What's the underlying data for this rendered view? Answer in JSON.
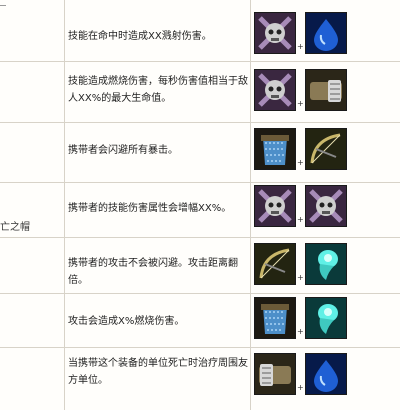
{
  "rows": [
    {
      "desc": "技能在命中时造成XX溅射伤害。",
      "icons": [
        "skull-crossbones-icon",
        "blue-drop-icon"
      ]
    },
    {
      "desc": "技能造成燃烧伤害，每秒伤害值相当于敌人XX%的最大生命值。",
      "icons": [
        "skull-crossbones-icon",
        "gauntlet-icon"
      ]
    },
    {
      "desc": "携带者会闪避所有暴击。",
      "icons": [
        "chainmail-icon",
        "bow-icon"
      ]
    },
    {
      "desc": "携带者的技能伤害属性会增幅XX%。",
      "icons": [
        "skull-crossbones-icon",
        "skull-crossbones-icon"
      ]
    },
    {
      "desc": "携带者的攻击不会被闪避。攻击距离翻倍。",
      "icons": [
        "bow-icon",
        "spirit-wisp-icon"
      ]
    },
    {
      "desc": "攻击会造成X%燃烧伤害。",
      "icons": [
        "chainmail-icon",
        "spirit-wisp-icon"
      ]
    },
    {
      "desc": "当携带这个装备的单位死亡时治疗周围友方单位。",
      "icons": [
        "gauntlet-icon",
        "blue-drop-icon"
      ]
    }
  ],
  "left_labels": {
    "row4": "亡之帽"
  },
  "plus": "+"
}
